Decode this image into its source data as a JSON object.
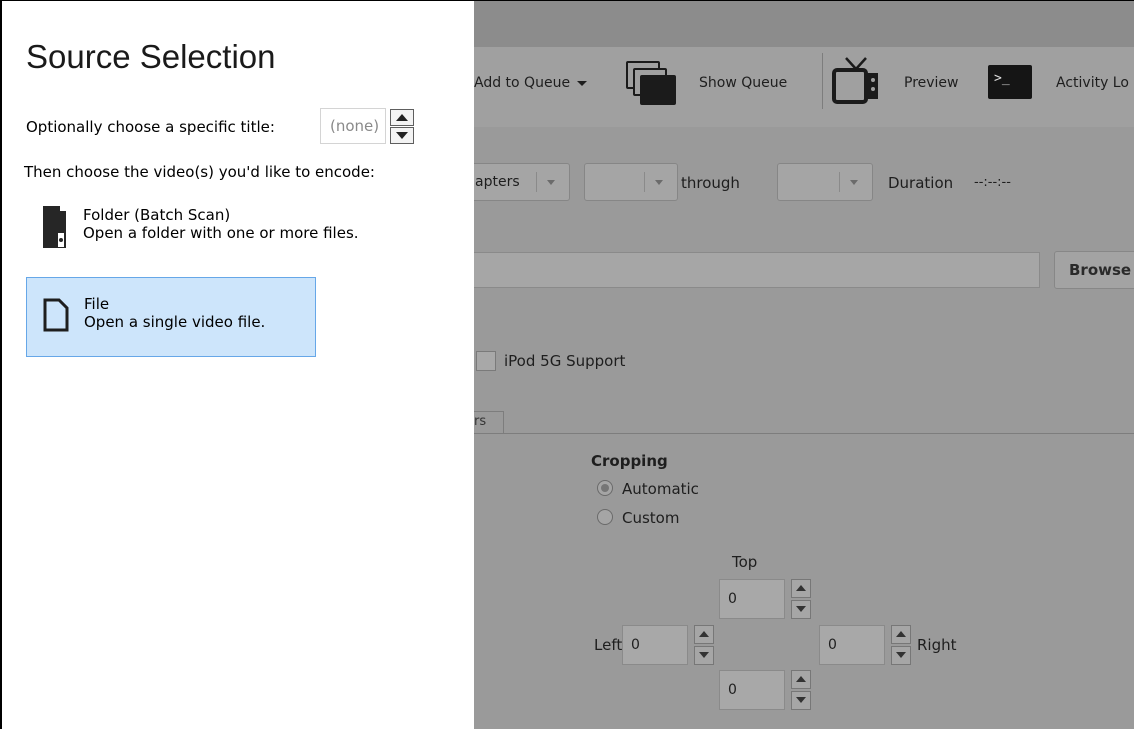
{
  "source_panel": {
    "title": "Source Selection",
    "title_prompt": "Optionally choose a specific title:",
    "title_value": "(none)",
    "videos_prompt": "Then choose the video(s) you'd like to encode:",
    "options": [
      {
        "name": "Folder (Batch Scan)",
        "description": "Open a folder with one or more files.",
        "icon": "folder-batch-icon",
        "selected": false
      },
      {
        "name": "File",
        "description": "Open a single video file.",
        "icon": "file-icon",
        "selected": true
      }
    ],
    "selection_color": "#cde5fb",
    "selection_border": "#66a7e8"
  },
  "app": {
    "toolbar": {
      "add_to_queue": "Add to Queue",
      "show_queue": "Show Queue",
      "preview": "Preview",
      "activity_log": "Activity Lo",
      "terminal_glyph": ">_"
    },
    "range": {
      "mode": "apters",
      "through": "through",
      "duration_label": "Duration",
      "duration_value": "--:--:--"
    },
    "destination": {
      "browse": "Browse"
    },
    "ipod_support": "iPod 5G Support",
    "tab_fragment": "rs",
    "cropping": {
      "heading": "Cropping",
      "automatic": "Automatic",
      "custom": "Custom",
      "selected": "Automatic",
      "top_label": "Top",
      "left_label": "Left",
      "right_label": "Right",
      "top": "0",
      "left": "0",
      "right": "0",
      "bottom": "0"
    },
    "dim_color": "#9a9a9a"
  }
}
